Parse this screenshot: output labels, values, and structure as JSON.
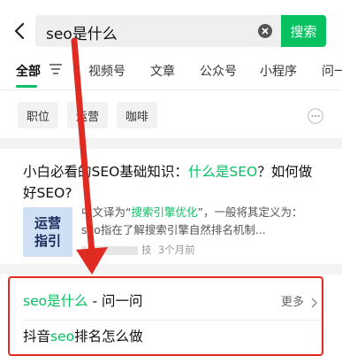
{
  "search": {
    "query": "seo是什么",
    "button_label": "搜索"
  },
  "tabs": [
    {
      "label": "全部",
      "active": true
    },
    {
      "label": "视频号"
    },
    {
      "label": "文章"
    },
    {
      "label": "公众号"
    },
    {
      "label": "小程序"
    },
    {
      "label": "问一"
    }
  ],
  "chips": [
    "职位",
    "运营",
    "咖啡"
  ],
  "result1": {
    "title_a": "小白必看",
    "title_b": "的SEO基础知识：",
    "title_hl": "什么是SEO",
    "title_c": "？如何做好SEO?",
    "thumb_line1": "运营",
    "thumb_line2": "指引",
    "desc_a": "中文译为“",
    "desc_hl": "搜索引擎优化",
    "desc_b": "”，一般将其定义为：seo指在了解搜索引擎自然排名机制...",
    "meta_source": "技",
    "meta_time": "3个月前"
  },
  "qa": {
    "title_hl": "seo是什么",
    "title_rest": " - 问一问",
    "more": "更多",
    "item_a": "抖音",
    "item_hl": "seo",
    "item_b": "排名怎么做"
  },
  "colors": {
    "accent": "#07c160",
    "annotation": "#e02b22"
  }
}
